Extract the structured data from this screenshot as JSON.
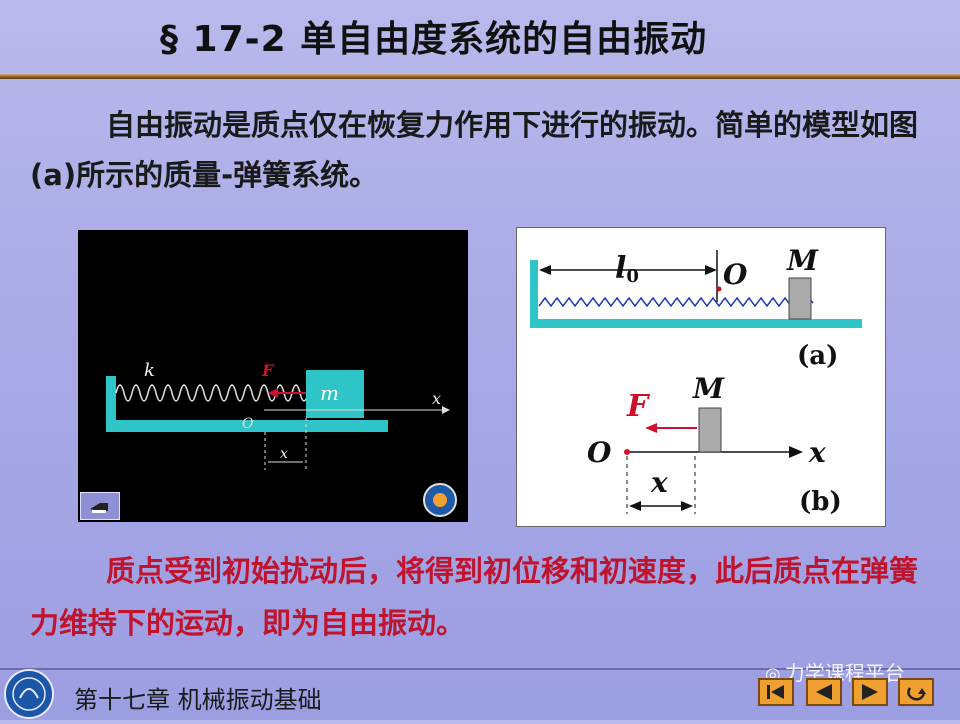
{
  "title": "§ 17-2  单自由度系统的自由振动",
  "paragraph1": "自由振动是质点仅在恢复力作用下进行的振动。简单的模型如图(a)所示的质量-弹簧系统。",
  "paragraph2": "质点受到初始扰动后，将得到初位移和初速度，此后质点在弹簧力维持下的运动，即为自由振动。",
  "animation": {
    "k": "k",
    "F": "F",
    "m": "m",
    "x_axis": "x",
    "O": "O",
    "x_disp": "x"
  },
  "diagram_a": {
    "l0": "l",
    "l0_sub": "0",
    "O": "O",
    "M": "M",
    "caption": "(a)"
  },
  "diagram_b": {
    "F": "F",
    "M": "M",
    "O": "O",
    "x_axis": "x",
    "x_disp": "x",
    "caption": "(b)"
  },
  "footer": {
    "chapter": "第十七章  机械振动基础",
    "watermark": "力学课程平台"
  },
  "nav_buttons": [
    "first-page",
    "previous",
    "next",
    "return"
  ],
  "colors": {
    "teal": "#2ec4c8",
    "red": "#d0102a",
    "spring": "#1e3cb4",
    "accent_text": "#c0142e"
  }
}
